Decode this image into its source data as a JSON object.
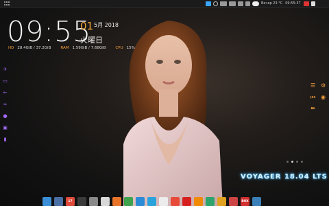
{
  "top_panel": {
    "weather_text": "Вечер 23 °C",
    "time_text": "09:55:37"
  },
  "clock": {
    "time": "09:55",
    "day": "01",
    "month_year": "5月 2018",
    "weekday": "火曜日"
  },
  "stats": {
    "hd_label": "HD",
    "hd_value": "28.4GiB / 37.2GiB",
    "ram_label": "RAM",
    "ram_value": "1.59GiB / 7.68GiB",
    "cpu_label": "CPU",
    "cpu_value": "15%"
  },
  "brand_text": "VOYAGER 18.04 LTS",
  "left_icons": [
    "airplane-icon",
    "chat-icon",
    "back-arrow-icon",
    "glasses-icon",
    "globe-icon",
    "lock-icon",
    "bar-chart-icon"
  ],
  "right_icons": [
    "menu-icon",
    "settings-icon",
    "skip-back-icon",
    "eye-icon",
    "arrow-left-icon"
  ],
  "dock": [
    {
      "name": "desktop-icon",
      "color": "#3a8fd6"
    },
    {
      "name": "files-icon",
      "color": "#4a6fa5"
    },
    {
      "name": "calendar-icon",
      "color": "#e04a3a",
      "label": "17"
    },
    {
      "name": "terminal-icon",
      "color": "#3a3a3a"
    },
    {
      "name": "editor-icon",
      "color": "#8a8a8a"
    },
    {
      "name": "document-viewer-icon",
      "color": "#d8d8d8"
    },
    {
      "name": "firefox-icon",
      "color": "#e8742a"
    },
    {
      "name": "chrome-icon",
      "color": "#3fa34d"
    },
    {
      "name": "browser-icon",
      "color": "#2b8bd6"
    },
    {
      "name": "telegram-icon",
      "color": "#2aa3dc"
    },
    {
      "name": "libreoffice-icon",
      "color": "#ececec"
    },
    {
      "name": "presentation-icon",
      "color": "#e84a3a"
    },
    {
      "name": "youtube-icon",
      "color": "#d62020"
    },
    {
      "name": "vlc-icon",
      "color": "#f08a00"
    },
    {
      "name": "vscode-icon",
      "color": "#2ea36b"
    },
    {
      "name": "download-icon",
      "color": "#e0a020"
    },
    {
      "name": "trash-icon",
      "color": "#c44"
    },
    {
      "name": "toolbox-icon",
      "color": "#d23030",
      "label": "BOX"
    },
    {
      "name": "system-settings-icon",
      "color": "#3a7fb8"
    }
  ],
  "colors": {
    "accent": "#f6a13b",
    "icon_purple": "#a76cff",
    "brand_glow": "#3fb6ff"
  }
}
